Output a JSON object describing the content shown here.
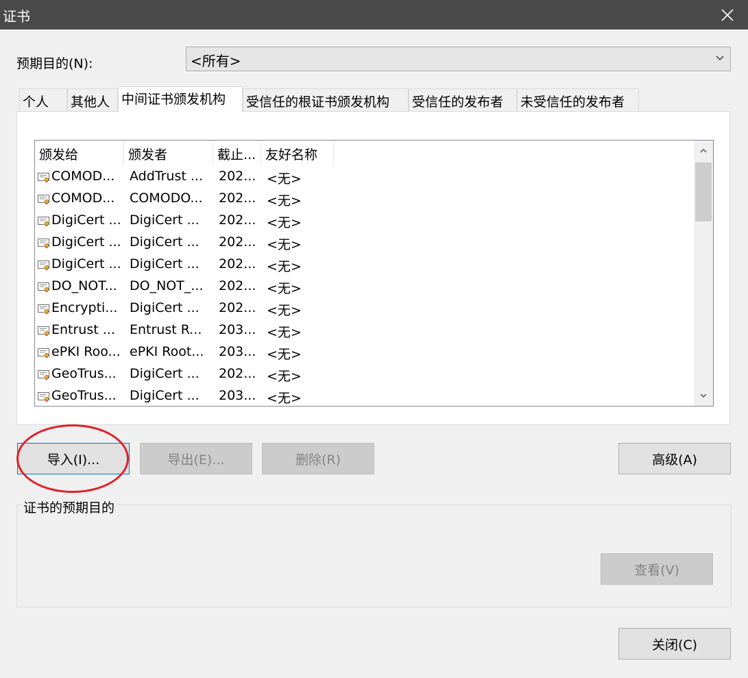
{
  "window": {
    "title": "证书"
  },
  "purpose": {
    "label": "预期目的(N):",
    "selected": "<所有>"
  },
  "tabs": [
    {
      "label": "个人"
    },
    {
      "label": "其他人"
    },
    {
      "label": "中间证书颁发机构"
    },
    {
      "label": "受信任的根证书颁发机构"
    },
    {
      "label": "受信任的发布者"
    },
    {
      "label": "未受信任的发布者"
    }
  ],
  "list": {
    "columns": [
      "颁发给",
      "颁发者",
      "截止...",
      "友好名称"
    ],
    "rows": [
      [
        "COMOD...",
        "AddTrust ...",
        "202...",
        "<无>"
      ],
      [
        "COMOD...",
        "COMODO...",
        "202...",
        "<无>"
      ],
      [
        "DigiCert ...",
        "DigiCert ...",
        "202...",
        "<无>"
      ],
      [
        "DigiCert ...",
        "DigiCert ...",
        "202...",
        "<无>"
      ],
      [
        "DigiCert ...",
        "DigiCert ...",
        "202...",
        "<无>"
      ],
      [
        "DO_NOT...",
        "DO_NOT_...",
        "202...",
        "<无>"
      ],
      [
        "Encrypti...",
        "DigiCert ...",
        "202...",
        "<无>"
      ],
      [
        "Entrust ...",
        "Entrust R...",
        "203...",
        "<无>"
      ],
      [
        "ePKI Roo...",
        "ePKI Root...",
        "203...",
        "<无>"
      ],
      [
        "GeoTrus...",
        "DigiCert ...",
        "202...",
        "<无>"
      ],
      [
        "GeoTrus...",
        "DigiCert ...",
        "203...",
        "<无>"
      ]
    ]
  },
  "buttons": {
    "import": "导入(I)...",
    "export": "导出(E)...",
    "remove": "删除(R)",
    "advanced": "高级(A)",
    "view": "查看(V)",
    "close": "关闭(C)"
  },
  "group": {
    "label": "证书的预期目的"
  },
  "colors": {
    "titlebar": "#4a4a4a",
    "annotation": "#e0202a",
    "focus": "#0078d7"
  }
}
